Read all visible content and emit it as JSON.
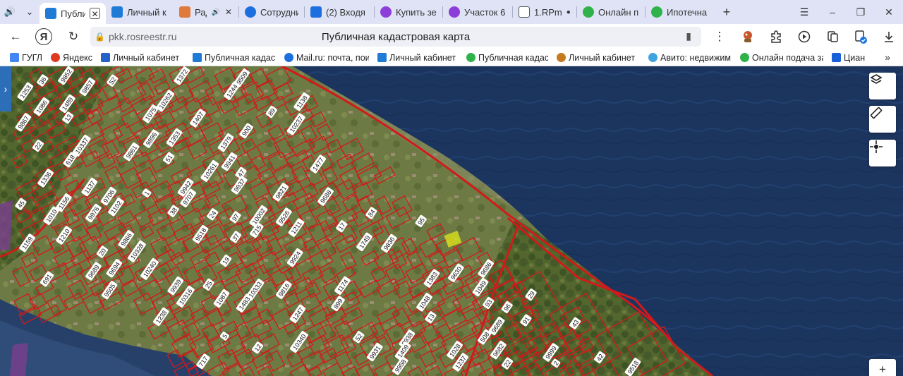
{
  "browser": {
    "tabs": [
      {
        "title": "Публи",
        "active": true,
        "color": "#1f7bd6",
        "close": "✕"
      },
      {
        "title": "Личный к",
        "active": false,
        "color": "#1f7bd6"
      },
      {
        "title": "Рад",
        "active": false,
        "color": "#e07a3a",
        "extra": "🔊",
        "close": "✕"
      },
      {
        "title": "Сотрудни",
        "active": false,
        "color": "#1d6fe0"
      },
      {
        "title": "(2) Входя",
        "active": false,
        "color": "#1d6fe0"
      },
      {
        "title": "Купить зе",
        "active": false,
        "color": "#8c3fd8"
      },
      {
        "title": "Участок 6",
        "active": false,
        "color": "#8c3fd8"
      },
      {
        "title": "1.RPm",
        "active": false,
        "color": "#555555",
        "dot": "●"
      },
      {
        "title": "Онлайн п",
        "active": false,
        "color": "#2fb24a"
      },
      {
        "title": "Ипотечна",
        "active": false,
        "color": "#2fb24a"
      }
    ],
    "new_tab": "+",
    "window": {
      "menu": "☰",
      "minimize": "–",
      "restore": "❐",
      "close": "✕"
    }
  },
  "navbar": {
    "back": "←",
    "yandex": "Я",
    "reload": "↻",
    "url": "pkk.rosreestr.ru",
    "page_title": "Публичная кадастровая карта",
    "bookmark": "▮",
    "more": "⋮"
  },
  "bookmarks": [
    {
      "label": "ГУГЛ",
      "color": "#4285f4"
    },
    {
      "label": "Яндекс",
      "color": "#e0391f"
    },
    {
      "label": "Личный кабинет",
      "color": "#2563c9"
    },
    {
      "label": "Публичная кадас",
      "color": "#1f7bd6"
    },
    {
      "label": "Mail.ru: почта, пои",
      "color": "#1d6fe0"
    },
    {
      "label": "Личный кабинет",
      "color": "#1f7bd6"
    },
    {
      "label": "Публичная кадас",
      "color": "#2fb24a"
    },
    {
      "label": "Личный кабинет",
      "color": "#c47a1e"
    },
    {
      "label": "Авито: недвижим",
      "color": "#3fa3e0"
    },
    {
      "label": "Онлайн подача за",
      "color": "#2fb24a"
    },
    {
      "label": "Циан",
      "color": "#1760d8"
    }
  ],
  "bookmarks_more": "»",
  "map": {
    "parcel_labels": [
      "9924",
      "1",
      "52",
      "2",
      "1407",
      "9816",
      "9518",
      "25",
      "36",
      "22",
      "24",
      "13",
      "17",
      "9937",
      "9938",
      "9939",
      "91",
      "52",
      "10333",
      "1336",
      "1137",
      "10328",
      "5",
      "1010",
      "1028",
      "51",
      "1372",
      "9931",
      "9836",
      "9857",
      "9505",
      "89",
      "22",
      "9689",
      "9630",
      "19",
      "20",
      "1247",
      "43",
      "9706",
      "9707",
      "9686",
      "9694",
      "1749",
      "9941",
      "9942",
      "1409",
      "38",
      "1379",
      "9861",
      "9852",
      "9821",
      "10237",
      "10240",
      "1253",
      "10340",
      "10337",
      "10316",
      "1211",
      "9526",
      "1210",
      "1174",
      "93",
      "1049",
      "1048",
      "1237",
      "97",
      "45",
      "1353",
      "1086",
      "1102",
      "1489",
      "9866",
      "9688",
      "9689",
      "10261",
      "9958",
      "9896",
      "13",
      "37",
      "9509",
      "42",
      "47",
      "29",
      "10262",
      "1477",
      "1383",
      "1075",
      "1483",
      "1138",
      "1159",
      "1238",
      "1087",
      "9867",
      "95",
      "84",
      "899",
      "900",
      "715",
      "691",
      "618",
      "717",
      "9682",
      "96",
      "10002",
      "9976",
      "9518",
      "9999",
      "508",
      "12",
      "1244",
      "1156"
    ],
    "tools": {
      "layers": "◈",
      "ruler": "✎",
      "locate": "⌖",
      "zoom_in": "+"
    },
    "side_handle": "›"
  },
  "colors": {
    "parcel_outline": "#d11a1a",
    "water": "#1c355f",
    "land": "#5f6f3a",
    "highlight": "#d8e11a"
  }
}
